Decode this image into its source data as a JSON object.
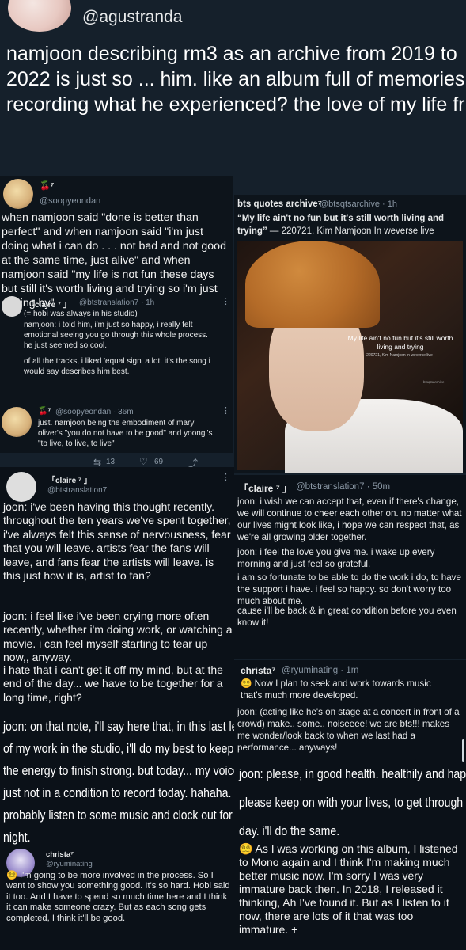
{
  "main_tweet": {
    "handle": "@agustranda",
    "text": "namjoon describing rm3 as an archive from 2019 to 2022 is just so ... him. like an album full of memories recording what he experienced? the love of my life fr"
  },
  "left_top": {
    "name": "🍒⁷",
    "handle": "@soopyeondan",
    "text": "when namjoon said \"done is better than perfect\" and when namjoon said \"i'm just doing what i can do . . . not bad and not good at the same time, just alive\" and when namjoon said \"my life is not fun these days but still it's worth living and trying so i'm just getting by\"",
    "quote": {
      "name": "「claire ⁷ 」",
      "handle": "@btstranslation7 · 1h",
      "line1": "(= hobi was always in his studio)",
      "line2": "namjoon: i told him, i'm just so happy, i really felt emotional seeing you go through this whole process. he just seemed so cool.",
      "line3": "of all the tracks, i liked 'equal sign' a lot. it's the song i would say describes him best."
    },
    "reply": {
      "name": "🍒⁷",
      "handle": "@soopyeondan · 36m",
      "text": "just. namjoon being the embodiment of mary oliver's \"you do not have to be good\" and yoongi's \"to live, to live, to live\"",
      "retweets": "13",
      "likes": "69"
    }
  },
  "right_top": {
    "name": "bts quotes archive⁷",
    "handle": "@btsqtsarchive · 1h",
    "quote_bold": "“My life ain't no fun but it's still worth living and trying”",
    "quote_rest": " — 220721, Kim Namjoon In weverse live",
    "overlay_main": "My life ain't no fun but it's still worth living and trying",
    "overlay_small": "220721, Kim Namjoon in weverse live",
    "watermark": "btsqtsarchive"
  },
  "left_mid": {
    "name": "「claire ⁷ 」",
    "handle": "@btstranslation7",
    "p1": "joon: i've been having this thought recently. throughout the ten years we've spent together, i've always felt this sense of nervousness, fear that you will leave. artists fear the fans will leave, and fans fear the artists will leave. is this just how it is, artist to fan?",
    "p2": "joon: i feel like i've been crying more often recently, whether i'm doing work, or watching a movie. i can feel myself starting to tear up now,, anyway.",
    "p3": "i hate that i can't get it off my mind, but at the end of the day... we have to be together for a long time, right?"
  },
  "left_cond": {
    "lines": [
      "joon: on that note, i'll say here that, in this last leg",
      "of my work in the studio, i'll do my best to keep up",
      "the energy to finish strong. but today... my voice is",
      "just not in a condition to record today. hahaha. i'll",
      "probably listen to some music and clock out for the",
      "night."
    ]
  },
  "left_bottom": {
    "name": "christa⁷",
    "handle": "@ryuminating",
    "text": "😵‍💫 I'm going to be more involved in the process. So I want to show you something good. It's so hard. Hobi said it too. And I have to spend so much time here and I think it can make someone crazy. But as each song gets completed, I think it'll be good."
  },
  "right_mid": {
    "name": "「claire ⁷ 」",
    "handle": "@btstranslation7 · 50m",
    "p1": "joon: i wish we can accept that, even if there's change, we will continue to cheer each other on. no matter what our lives might look like, i hope we can respect that, as we're all growing older together.",
    "p2": "joon: i feel the love you give me. i wake up every morning and just feel so grateful.",
    "p3": "i am so fortunate to be able to do the work i do, to have the support i have. i feel so happy. so don't worry too much about me.",
    "p4": "cause i'll be back & in great condition before you even know it!"
  },
  "right_christa": {
    "name": "christa⁷",
    "handle": "@ryuminating · 1m",
    "p1": "😵‍💫 Now I plan to seek and work towards music that's much more developed.",
    "p2": "joon: (acting like he's on stage at a concert in front of a crowd) make.. some.. noiseeee! we are bts!!! makes me wonder/look back to when we last had a performance... anyways!"
  },
  "right_cond": {
    "lines": [
      "joon: please, in good health. healthily and happily!",
      "please keep on with your lives, to get through each",
      "day. i'll do the same."
    ]
  },
  "right_bottom": {
    "text": "😵‍💫 As I was working on this album, I listened to Mono again and I think I'm making much better music now. I'm sorry I was very immature back then. In 2018, I released it thinking, Ah I've found it. But as I listen to it now, there are lots of it that was too immature. +"
  }
}
